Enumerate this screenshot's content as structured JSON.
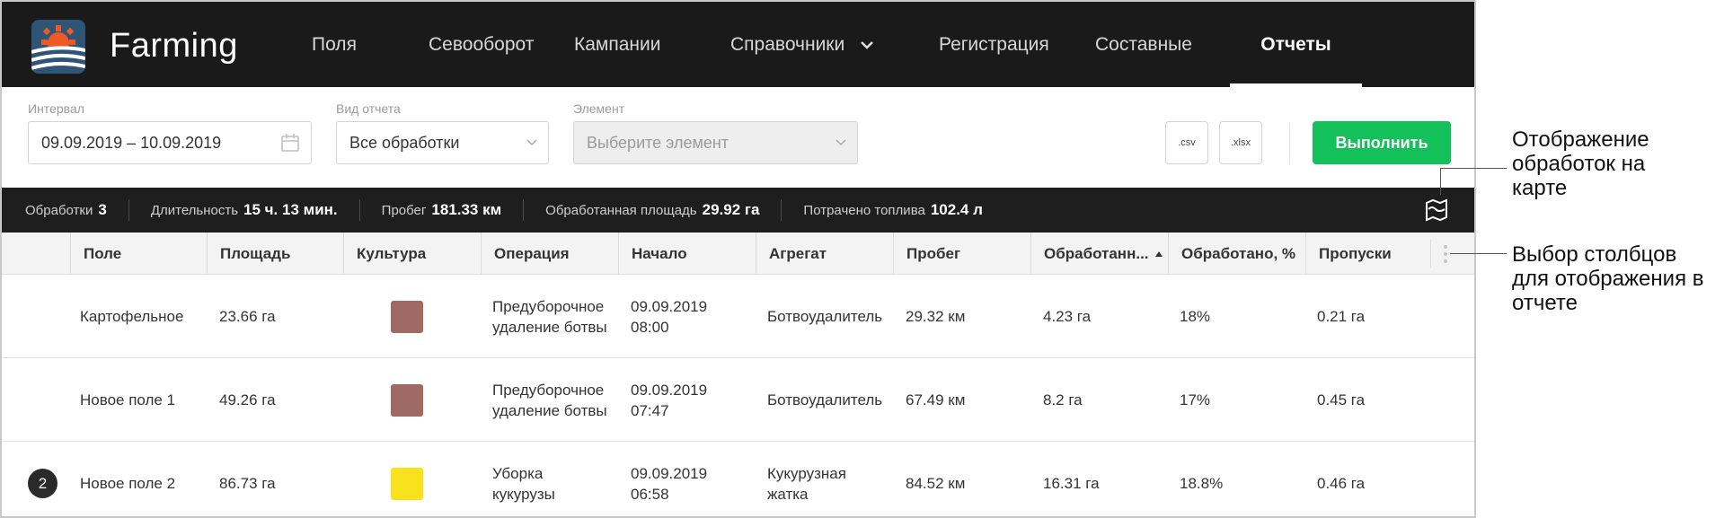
{
  "app": {
    "name": "Farming"
  },
  "nav": [
    {
      "label": "Поля"
    },
    {
      "label": "Севооборот"
    },
    {
      "label": "Кампании"
    },
    {
      "label": "Справочники"
    },
    {
      "label": "Регистрация"
    },
    {
      "label": "Составные"
    },
    {
      "label": "Отчеты"
    }
  ],
  "filters": {
    "interval": {
      "label": "Интервал",
      "value": "09.09.2019 – 10.09.2019"
    },
    "report_type": {
      "label": "Вид отчета",
      "value": "Все обработки"
    },
    "element": {
      "label": "Элемент",
      "placeholder": "Выберите элемент"
    },
    "csv_label": ".csv",
    "xlsx_label": ".xlsx",
    "run_label": "Выполнить"
  },
  "stats": [
    {
      "label": "Обработки",
      "value": "3"
    },
    {
      "label": "Длительность",
      "value": "15 ч. 13 мин."
    },
    {
      "label": "Пробег",
      "value": "181.33 км"
    },
    {
      "label": "Обработанная площадь",
      "value": "29.92 га"
    },
    {
      "label": "Потрачено топлива",
      "value": "102.4 л"
    }
  ],
  "table": {
    "columns": [
      "Поле",
      "Площадь",
      "Культура",
      "Операция",
      "Начало",
      "Агрегат",
      "Пробег",
      "Обработанн...",
      "Обработано, %",
      "Пропуски"
    ],
    "rows": [
      {
        "badge": "",
        "field": "Картофельное",
        "area": "23.66 га",
        "crop_color": "#9e6a63",
        "operation_1": "Предуборочное",
        "operation_2": "удаление ботвы",
        "start_date": "09.09.2019",
        "start_time": "08:00",
        "aggregate_1": "Ботвоудалитель",
        "aggregate_2": "",
        "mileage": "29.32 км",
        "processed": "4.23 га",
        "percent": "18%",
        "gaps": "0.21 га"
      },
      {
        "badge": "",
        "field": "Новое поле 1",
        "area": "49.26 га",
        "crop_color": "#9e6a63",
        "operation_1": "Предуборочное",
        "operation_2": "удаление ботвы",
        "start_date": "09.09.2019",
        "start_time": "07:47",
        "aggregate_1": "Ботвоудалитель",
        "aggregate_2": "",
        "mileage": "67.49 км",
        "processed": "8.2 га",
        "percent": "17%",
        "gaps": "0.45 га"
      },
      {
        "badge": "2",
        "field": "Новое поле 2",
        "area": "86.73 га",
        "crop_color": "#f7e21b",
        "operation_1": "Уборка",
        "operation_2": "кукурузы",
        "start_date": "09.09.2019",
        "start_time": "06:58",
        "aggregate_1": "Кукурузная",
        "aggregate_2": "жатка",
        "mileage": "84.52 км",
        "processed": "16.31 га",
        "percent": "18.8%",
        "gaps": "0.46 га"
      }
    ]
  },
  "annotations": {
    "map": [
      "Отображение",
      "обработок на",
      "карте"
    ],
    "columns": [
      "Выбор столбцов",
      "для отображения в",
      "отчете"
    ]
  }
}
